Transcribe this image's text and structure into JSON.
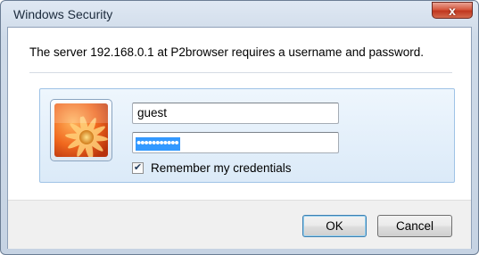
{
  "window": {
    "title": "Windows Security",
    "close_glyph": "x"
  },
  "message": "The server 192.168.0.1 at P2browser requires a username and password.",
  "credentials": {
    "tile_icon": "flower-icon",
    "username_value": "guest",
    "password_mask": "•••••••••••",
    "remember_checked": true,
    "remember_label": "Remember my credentials"
  },
  "buttons": {
    "ok_label": "OK",
    "cancel_label": "Cancel"
  },
  "colors": {
    "selection": "#3399ff",
    "panel_border": "#9fc3e6",
    "close_button": "#c0371f"
  }
}
